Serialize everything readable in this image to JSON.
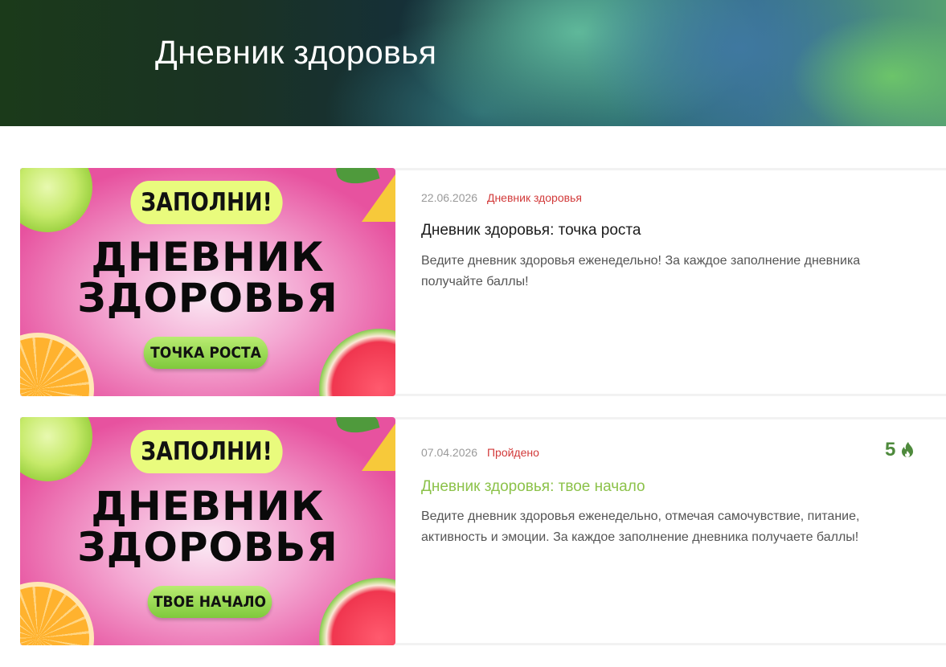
{
  "header": {
    "title": "Дневник здоровья"
  },
  "cards": [
    {
      "date": "22.06.2026",
      "category": "Дневник здоровья",
      "title": "Дневник здоровья: точка роста",
      "description": "Ведите дневник здоровья еженедельно! За каждое заполнение дневника получайте баллы!",
      "banner": {
        "top": "ЗАПОЛНИ!",
        "line1": "ДНЕВНИК",
        "line2": "ЗДОРОВЬЯ",
        "bottom": "ТОЧКА РОСТА"
      }
    },
    {
      "date": "07.04.2026",
      "category": "Пройдено",
      "title": "Дневник здоровья: твое начало",
      "description": "Ведите дневник здоровья еженедельно, отмечая самочувствие, питание, активность и эмоции. За каждое заполнение дневника получаете баллы!",
      "points": "5",
      "points_icon": "flame-icon",
      "banner": {
        "top": "ЗАПОЛНИ!",
        "line1": "ДНЕВНИК",
        "line2": "ЗДОРОВЬЯ",
        "bottom": "ТВОЕ НАЧАЛО"
      }
    }
  ],
  "colors": {
    "accent_red": "#d23a3a",
    "accent_green": "#8cc24a",
    "points_green": "#4e8a3c"
  }
}
